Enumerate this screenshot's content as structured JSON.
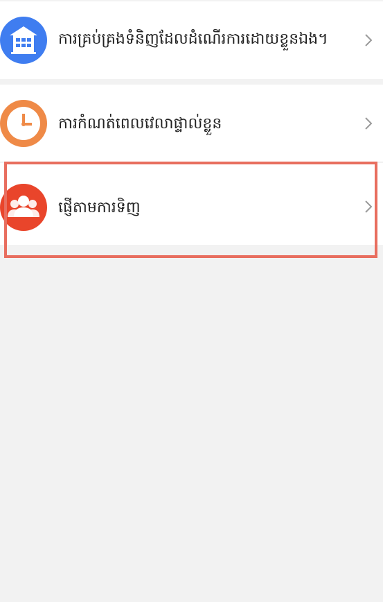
{
  "menu": {
    "items": [
      {
        "label": "ការគ្រប់គ្រងទំនិញដែលដំណើរការដោយខ្លួនឯង។",
        "icon": "building-icon",
        "icon_color": "#3f7df0"
      },
      {
        "label": "ការកំណត់ពេលវេលាផ្ទាល់ខ្លួន",
        "icon": "clock-icon",
        "icon_color": "#ef8a47"
      },
      {
        "label": "ផ្ញើតាមការទិញ",
        "icon": "group-users-icon",
        "icon_color": "#e9452b",
        "highlighted": true
      }
    ],
    "chevron_icon": "chevron-right-icon"
  },
  "highlight": {
    "color": "#e86e5f"
  }
}
